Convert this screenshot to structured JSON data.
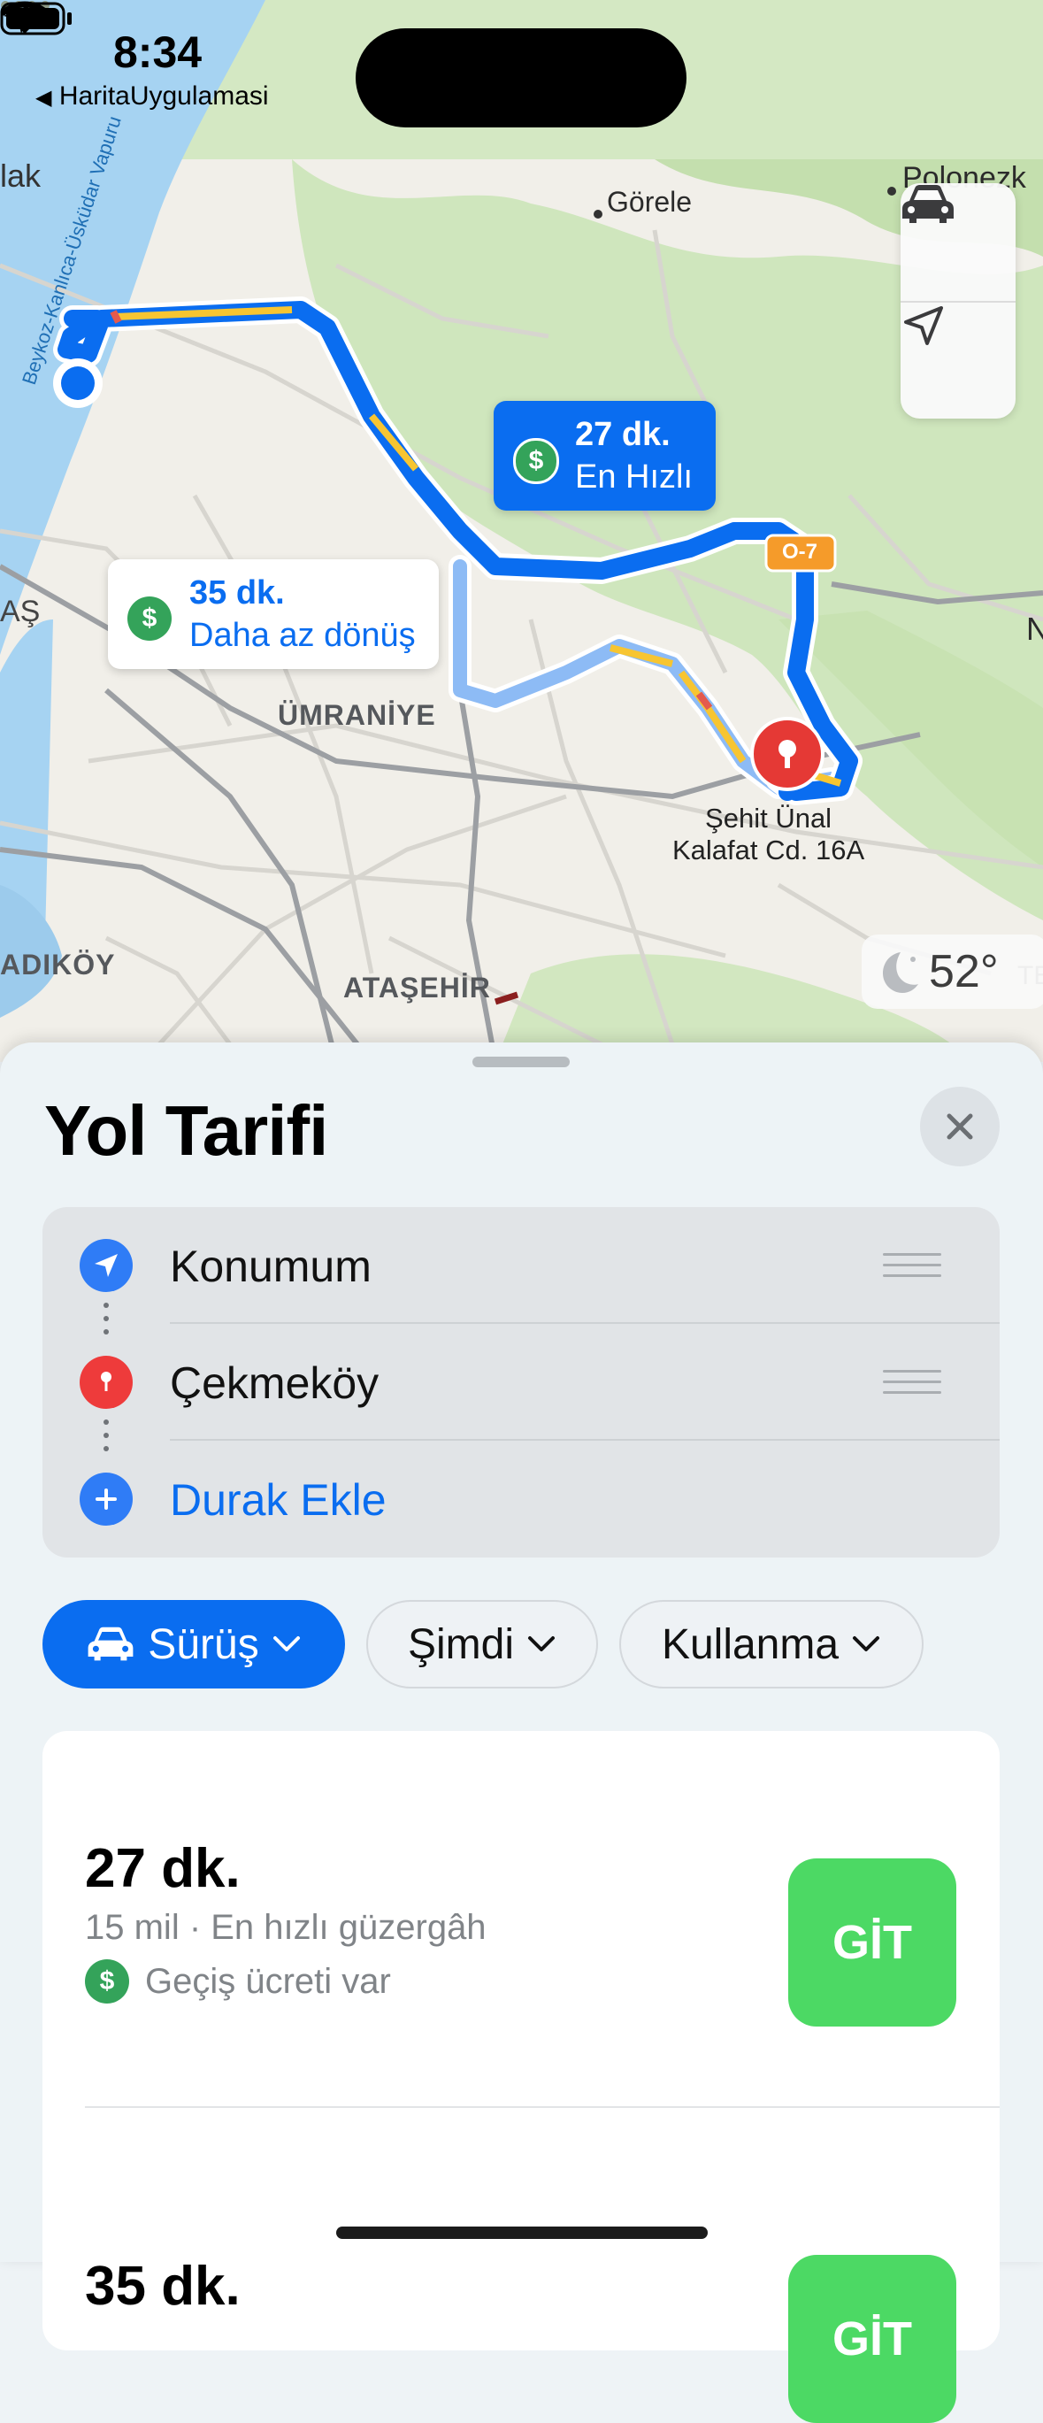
{
  "status_bar": {
    "time": "8:34",
    "back_label": "HaritaUygulamasi"
  },
  "map": {
    "labels": {
      "gorele": "Görele",
      "polonezkoy": "Polonezk",
      "lak": "lak",
      "as": "AŞ",
      "umraniye": "ÜMRANİYE",
      "kadikoy": "ADIKÖY",
      "atasehir": "ATAŞEHİR",
      "ferry": "Beykoz-Kanlıca-Üsküdar Vapuru",
      "highway": "O-7",
      "n_edge": "N",
      "te_edge": "TE"
    },
    "callout_fast": {
      "time": "27 dk.",
      "tag": "En Hızlı"
    },
    "callout_alt": {
      "time": "35 dk.",
      "tag": "Daha az dönüş"
    },
    "destination": {
      "line1": "Şehit Ünal",
      "line2": "Kalafat Cd. 16A"
    },
    "weather": "52°",
    "route_color": "#0a6df0",
    "traffic_color": "#f7c531"
  },
  "sheet": {
    "title": "Yol Tarifi",
    "waypoints": [
      {
        "label": "Konumum",
        "icon": "location-arrow-icon"
      },
      {
        "label": "Çekmeköy",
        "icon": "map-pin-icon"
      },
      {
        "label": "Durak Ekle",
        "icon": "plus-icon"
      }
    ],
    "filters": {
      "mode": "Sürüş",
      "time": "Şimdi",
      "avoid": "Kullanma"
    },
    "routes": [
      {
        "time": "27 dk.",
        "meta": "15 mil · En hızlı güzergâh",
        "toll": "Geçiş ücreti var",
        "go": "GİT"
      },
      {
        "time": "35 dk.",
        "go": "GİT"
      }
    ]
  }
}
